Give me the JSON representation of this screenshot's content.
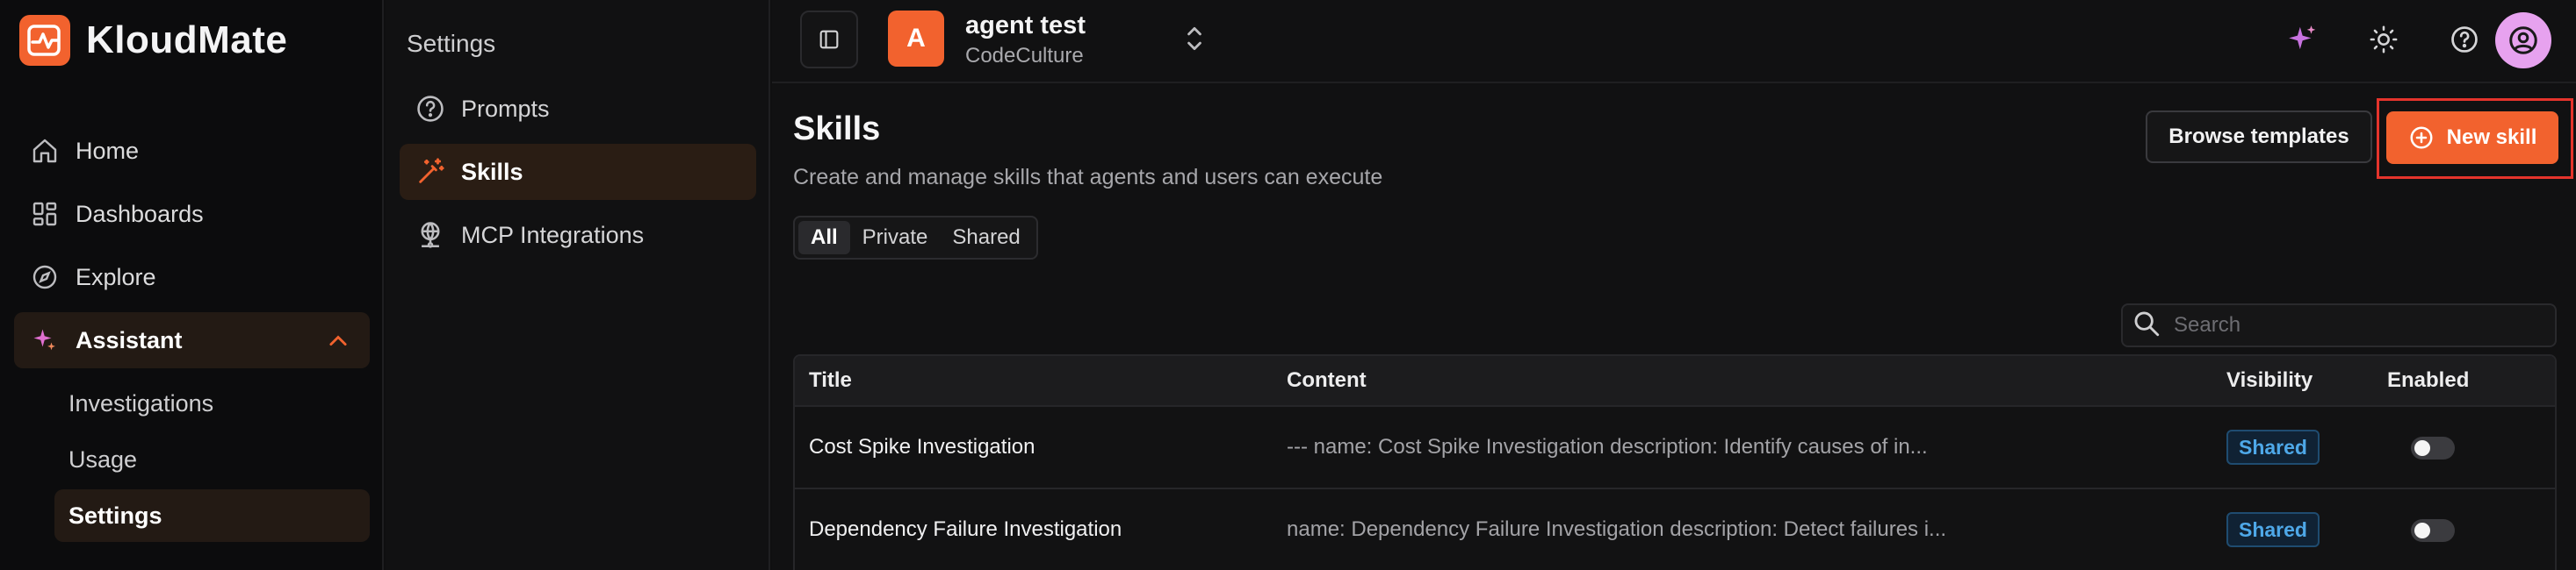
{
  "brand": {
    "name": "KloudMate",
    "accent": "#f2622e"
  },
  "sidebar": {
    "items": [
      {
        "label": "Home",
        "icon": "home-icon"
      },
      {
        "label": "Dashboards",
        "icon": "dashboard-icon"
      },
      {
        "label": "Explore",
        "icon": "compass-icon"
      },
      {
        "label": "Assistant",
        "icon": "sparkle-icon",
        "expanded": true
      }
    ],
    "sub_items": [
      {
        "label": "Investigations"
      },
      {
        "label": "Usage"
      },
      {
        "label": "Settings",
        "active": true
      }
    ]
  },
  "settings_menu": {
    "title": "Settings",
    "items": [
      {
        "label": "Prompts",
        "icon": "help-circle-icon"
      },
      {
        "label": "Skills",
        "icon": "magic-wand-icon",
        "active": true
      },
      {
        "label": "MCP Integrations",
        "icon": "globe-network-icon"
      }
    ]
  },
  "topbar": {
    "org_initial": "A",
    "org_name": "agent test",
    "org_sub": "CodeCulture"
  },
  "page": {
    "title": "Skills",
    "subtitle": "Create and manage skills that agents and users can execute",
    "browse_label": "Browse templates",
    "new_label": "New skill",
    "filters": [
      "All",
      "Private",
      "Shared"
    ],
    "active_filter": "All",
    "search_placeholder": "Search"
  },
  "table": {
    "columns": [
      "Title",
      "Content",
      "Visibility",
      "Enabled"
    ],
    "rows": [
      {
        "title": "Cost Spike Investigation",
        "content": "--- name: Cost Spike Investigation description: Identify causes of in...",
        "visibility": "Shared",
        "enabled": false
      },
      {
        "title": "Dependency Failure Investigation",
        "content": "name: Dependency Failure Investigation description: Detect failures i...",
        "visibility": "Shared",
        "enabled": false
      }
    ]
  }
}
